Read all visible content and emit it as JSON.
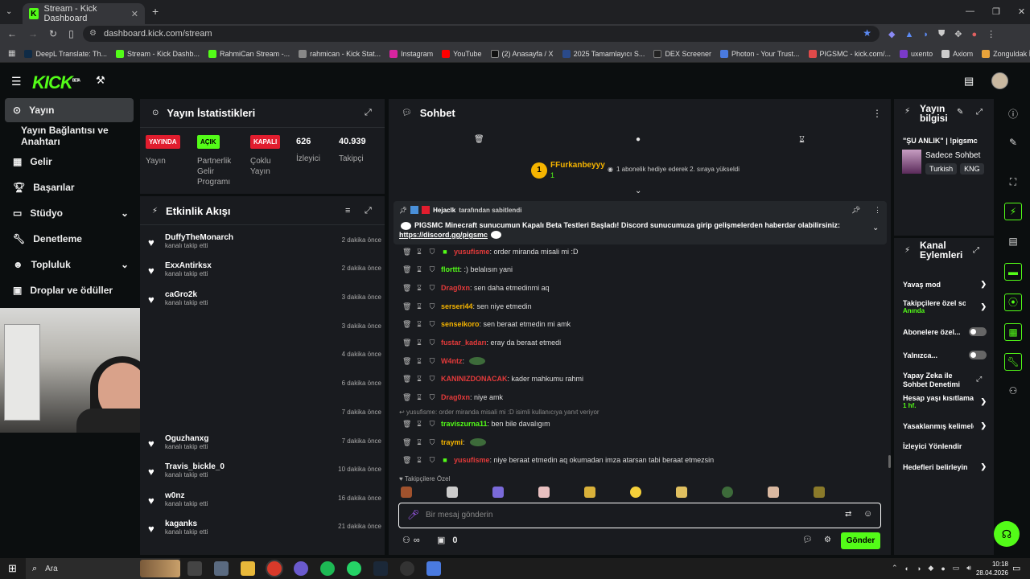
{
  "browser": {
    "tab_title": "Stream - Kick Dashboard",
    "url": "dashboard.kick.com/stream",
    "bookmarks": [
      "DeepL Translate: Th...",
      "Stream - Kick Dashb...",
      "RahmiCan Stream -...",
      "rahmican - Kick Stat...",
      "Instagram",
      "YouTube",
      "(2) Anasayfa / X",
      "2025 Tamamlayıcı S...",
      "DEX Screener",
      "Photon - Your Trust...",
      "PIGSMC - kick.com/...",
      "uxento",
      "Axiom",
      "Zonguldak İngilizce..."
    ]
  },
  "kick": {
    "logo": "KICK",
    "logo_sup": "BETA"
  },
  "nav": [
    {
      "label": "Yayın"
    },
    {
      "label": "Yayın Bağlantısı ve Anahtarı"
    },
    {
      "label": "Gelir"
    },
    {
      "label": "Başarılar"
    },
    {
      "label": "Stüdyo"
    },
    {
      "label": "Denetleme"
    },
    {
      "label": "Topluluk"
    },
    {
      "label": "Droplar ve ödüller"
    }
  ],
  "stats": {
    "title": "Yayın İstatistikleri",
    "items": [
      {
        "badge": "YAYINDA",
        "label": "Yayın"
      },
      {
        "badge": "AÇIK",
        "label": "Partnerlik Gelir Programı"
      },
      {
        "badge": "KAPALI",
        "label": "Çoklu Yayın"
      },
      {
        "value": "626",
        "label": "İzleyici"
      },
      {
        "value": "40.939",
        "label": "Takipçi"
      }
    ]
  },
  "feed": {
    "title": "Etkinlik Akışı",
    "items": [
      {
        "name": "DuffyTheMonarch",
        "sub": "kanalı takip etti",
        "time": "2 dakika önce"
      },
      {
        "name": "ExxAntirksx",
        "sub": "kanalı takip etti",
        "time": "2 dakika önce"
      },
      {
        "name": "caGro2k",
        "sub": "kanalı takip etti",
        "time": "3 dakika önce"
      },
      {
        "name": "",
        "sub": "",
        "time": "3 dakika önce"
      },
      {
        "name": "",
        "sub": "",
        "time": "4 dakika önce"
      },
      {
        "name": "",
        "sub": "",
        "time": "6 dakika önce"
      },
      {
        "name": "",
        "sub": "",
        "time": "7 dakika önce"
      },
      {
        "name": "Oguzhanxg",
        "sub": "kanalı takip etti",
        "time": "7 dakika önce"
      },
      {
        "name": "Travis_bickle_0",
        "sub": "kanalı takip etti",
        "time": "10 dakika önce"
      },
      {
        "name": "w0nz",
        "sub": "kanalı takip etti",
        "time": "16 dakika önce"
      },
      {
        "name": "kaganks",
        "sub": "kanalı takip etti",
        "time": "21 dakika önce"
      }
    ]
  },
  "chat": {
    "title": "Sohbet",
    "gift_user": "FFurkanbeyyy",
    "gift_count": "1",
    "gift_text": "1 abonelik hediye ederek 2. sıraya yükseldi",
    "pinned_by": "Hejaclk",
    "pinned_suffix": "tarafından sabitlendi",
    "pinned_text": "PIGSMC Minecraft sunucumun Kapalı Beta Testleri Başladı! Discord sunucumuza girip gelişmelerden haberdar olabilirsiniz:",
    "pinned_link": "https://discord.gg/pigsmc",
    "messages": [
      {
        "user": "yusufisme",
        "color": "#e33a3a",
        "text": ": order miranda misali mi :D"
      },
      {
        "user": "florttt",
        "color": "#53fc18",
        "text": ": :) belalısın yani"
      },
      {
        "user": "Drag0xn",
        "color": "#e33a3a",
        "text": ": sen daha etmedinmi aq"
      },
      {
        "user": "serseri44",
        "color": "#f5b400",
        "text": ": sen niye etmedin"
      },
      {
        "user": "senseikoro",
        "color": "#f5b400",
        "text": ": sen beraat etmedin mi amk"
      },
      {
        "user": "fustar_kadarı",
        "color": "#e33a3a",
        "text": ": eray da beraat etmedi"
      },
      {
        "user": "W4ntz",
        "color": "#e33a3a",
        "text": ":"
      },
      {
        "user": "KANINIZDONACAK",
        "color": "#e33a3a",
        "text": ": kader mahkumu rahmi"
      },
      {
        "user": "Drag0xn",
        "color": "#e33a3a",
        "text": ": niye amk"
      },
      {
        "user": "traviszurna11",
        "color": "#53fc18",
        "text": ": ben bile davalıgım"
      },
      {
        "user": "traymi",
        "color": "#f5b400",
        "text": ":"
      },
      {
        "user": "yusufisme",
        "color": "#e33a3a",
        "text": ": niye beraat etmedin aq okumadan imza atarsan tabi beraat etmezsin"
      }
    ],
    "reply_text": "yusufisme: order miranda misali mi :D isimli kullanıcıya yanıt veriyor",
    "emote_label": "Takipçilere Özel",
    "input_placeholder": "Bir mesaj gönderin",
    "points": "0",
    "send": "Gönder"
  },
  "stream_info": {
    "title": "Yayın bilgisi",
    "stream_title": "\"ŞU ANLIK\" | !pigsmc",
    "category": "Sadece Sohbet",
    "tags": [
      "Turkish",
      "KNG"
    ]
  },
  "channel_actions": {
    "title": "Kanal Eylemleri",
    "items": [
      {
        "label": "Yavaş mod"
      },
      {
        "label": "Takipçilere özel sohbet",
        "sub": "Anında"
      },
      {
        "label": "Abonelere özel..."
      },
      {
        "label": "Yalnızca..."
      },
      {
        "label": "Yapay Zeka ile Sohbet Denetimi"
      },
      {
        "label": "Hesap yaşı kısıtlaması",
        "sub": "1 hf."
      },
      {
        "label": "Yasaklanmış kelimeler"
      },
      {
        "label": "İzleyici Yönlendir"
      },
      {
        "label": "Hedefleri belirleyin"
      }
    ]
  },
  "taskbar": {
    "search": "Ara",
    "time": "10:18",
    "date": "28.04.2026"
  },
  "colors": {
    "accent": "#53fc18",
    "live_red": "#e11d2e"
  }
}
